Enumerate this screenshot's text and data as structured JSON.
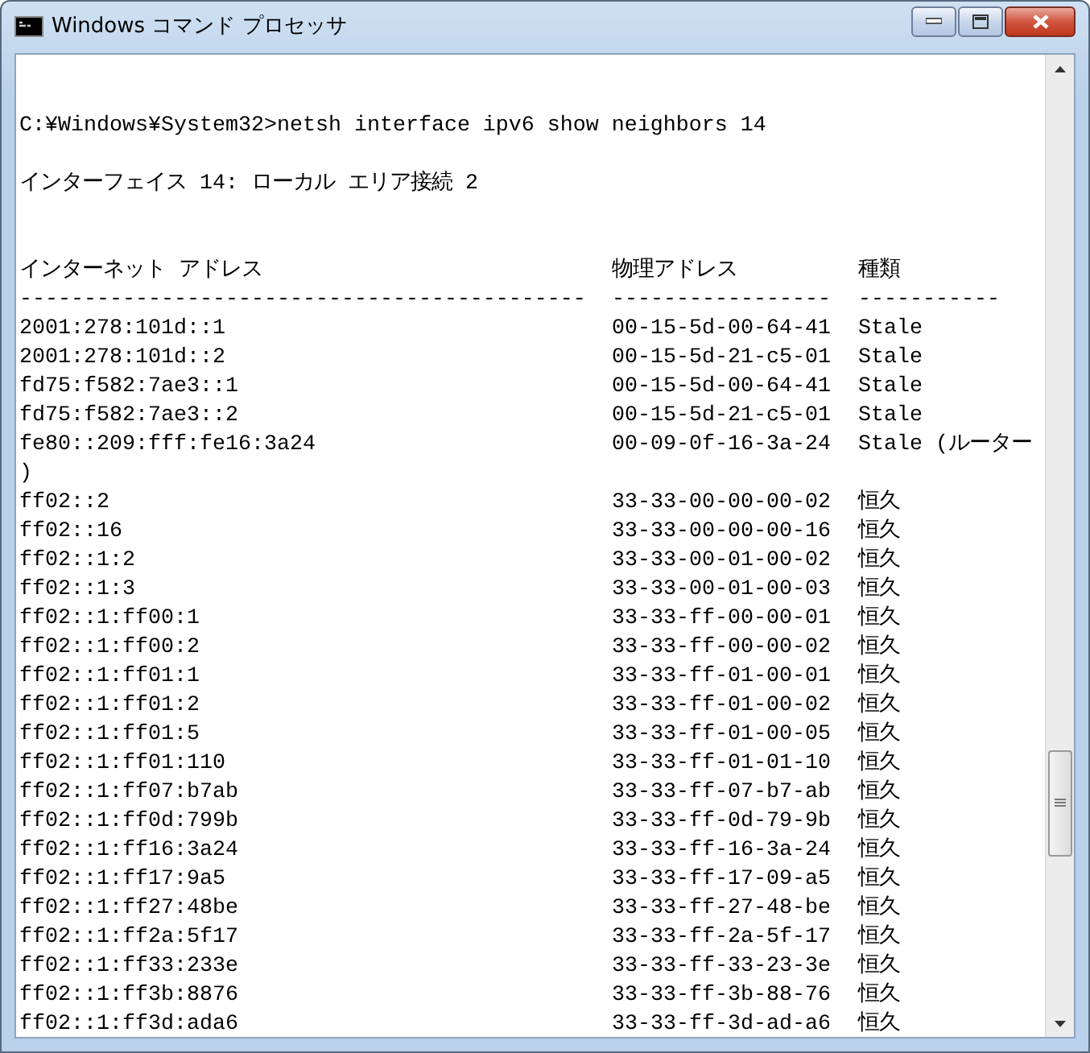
{
  "window": {
    "title": "Windows コマンド プロセッサ"
  },
  "console": {
    "command": "C:¥Windows¥System32>netsh interface ipv6 show neighbors 14",
    "interface_line": "インターフェイス 14: ローカル エリア接続 2",
    "columns": [
      "インターネット アドレス",
      "物理アドレス",
      "種類"
    ],
    "separators": [
      "--------------------------------------------",
      "-----------------",
      "-----------"
    ],
    "rows": [
      {
        "address": "2001:278:101d::1",
        "mac": "00-15-5d-00-64-41",
        "type": "Stale"
      },
      {
        "address": "2001:278:101d::2",
        "mac": "00-15-5d-21-c5-01",
        "type": "Stale"
      },
      {
        "address": "fd75:f582:7ae3::1",
        "mac": "00-15-5d-00-64-41",
        "type": "Stale"
      },
      {
        "address": "fd75:f582:7ae3::2",
        "mac": "00-15-5d-21-c5-01",
        "type": "Stale"
      },
      {
        "address": "fe80::209:fff:fe16:3a24",
        "mac": "00-09-0f-16-3a-24",
        "type": "Stale (ルーター",
        "wrap": ")"
      },
      {
        "address": "ff02::2",
        "mac": "33-33-00-00-00-02",
        "type": "恒久"
      },
      {
        "address": "ff02::16",
        "mac": "33-33-00-00-00-16",
        "type": "恒久"
      },
      {
        "address": "ff02::1:2",
        "mac": "33-33-00-01-00-02",
        "type": "恒久"
      },
      {
        "address": "ff02::1:3",
        "mac": "33-33-00-01-00-03",
        "type": "恒久"
      },
      {
        "address": "ff02::1:ff00:1",
        "mac": "33-33-ff-00-00-01",
        "type": "恒久"
      },
      {
        "address": "ff02::1:ff00:2",
        "mac": "33-33-ff-00-00-02",
        "type": "恒久"
      },
      {
        "address": "ff02::1:ff01:1",
        "mac": "33-33-ff-01-00-01",
        "type": "恒久"
      },
      {
        "address": "ff02::1:ff01:2",
        "mac": "33-33-ff-01-00-02",
        "type": "恒久"
      },
      {
        "address": "ff02::1:ff01:5",
        "mac": "33-33-ff-01-00-05",
        "type": "恒久"
      },
      {
        "address": "ff02::1:ff01:110",
        "mac": "33-33-ff-01-01-10",
        "type": "恒久"
      },
      {
        "address": "ff02::1:ff07:b7ab",
        "mac": "33-33-ff-07-b7-ab",
        "type": "恒久"
      },
      {
        "address": "ff02::1:ff0d:799b",
        "mac": "33-33-ff-0d-79-9b",
        "type": "恒久"
      },
      {
        "address": "ff02::1:ff16:3a24",
        "mac": "33-33-ff-16-3a-24",
        "type": "恒久"
      },
      {
        "address": "ff02::1:ff17:9a5",
        "mac": "33-33-ff-17-09-a5",
        "type": "恒久"
      },
      {
        "address": "ff02::1:ff27:48be",
        "mac": "33-33-ff-27-48-be",
        "type": "恒久"
      },
      {
        "address": "ff02::1:ff2a:5f17",
        "mac": "33-33-ff-2a-5f-17",
        "type": "恒久"
      },
      {
        "address": "ff02::1:ff33:233e",
        "mac": "33-33-ff-33-23-3e",
        "type": "恒久"
      },
      {
        "address": "ff02::1:ff3b:8876",
        "mac": "33-33-ff-3b-88-76",
        "type": "恒久"
      },
      {
        "address": "ff02::1:ff3d:ada6",
        "mac": "33-33-ff-3d-ad-a6",
        "type": "恒久"
      }
    ]
  }
}
